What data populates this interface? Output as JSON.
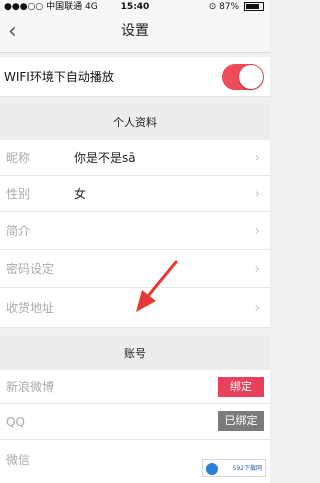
{
  "status_bar": {
    "carrier": "中国联通",
    "network": "4G",
    "time": "15:40",
    "battery": "87%"
  },
  "nav": {
    "title": "设置"
  },
  "autoplay": {
    "label": "WIFI环境下自动播放",
    "enabled": true
  },
  "profile": {
    "header": "个人资料",
    "rows": [
      {
        "label": "昵称",
        "value": "你是不是sā"
      },
      {
        "label": "性别",
        "value": "女"
      },
      {
        "label": "简介",
        "value": ""
      },
      {
        "label": "密码设定",
        "value": ""
      },
      {
        "label": "收货地址",
        "value": ""
      }
    ]
  },
  "account": {
    "header": "账号",
    "rows": [
      {
        "label": "新浪微博",
        "action": "绑定"
      },
      {
        "label": "QQ",
        "action": "已绑定"
      },
      {
        "label": "微信",
        "action": ""
      }
    ]
  },
  "watermark": {
    "text": "592下载网"
  },
  "colors": {
    "accent": "#ef4b5a",
    "bind_button": "#e9405b",
    "bound_button": "#7b7b7b",
    "annotation_arrow": "#e53935"
  },
  "icons": {
    "back": "chevron-left-icon",
    "row_arrow": "chevron-right-icon",
    "signal": "signal-icon",
    "lock": "rotation-lock-icon"
  }
}
